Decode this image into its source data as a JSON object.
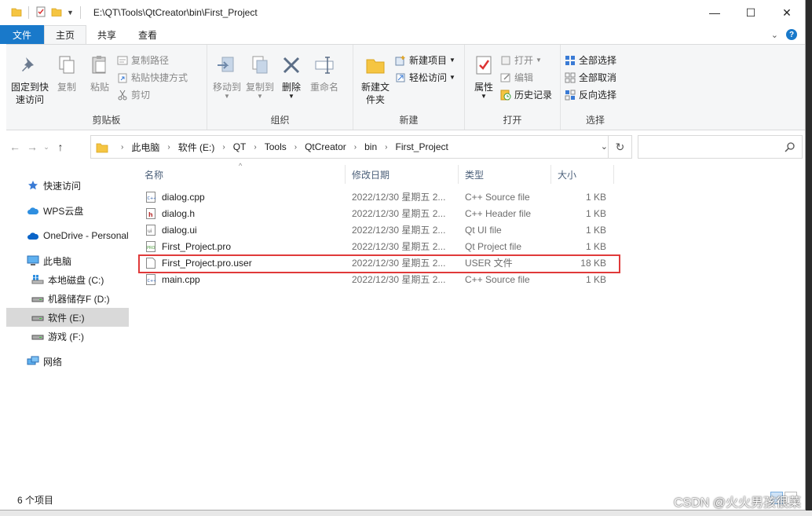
{
  "window": {
    "path": "E:\\QT\\Tools\\QtCreator\\bin\\First_Project",
    "minimize": "—",
    "maximize": "☐",
    "close": "✕"
  },
  "tabs": {
    "file": "文件",
    "home": "主页",
    "share": "共享",
    "view": "查看"
  },
  "ribbon": {
    "clipboard": {
      "label": "剪贴板",
      "pin": "固定到快速访问",
      "copy": "复制",
      "paste": "粘贴",
      "copy_path": "复制路径",
      "paste_shortcut": "粘贴快捷方式",
      "cut": "剪切"
    },
    "organize": {
      "label": "组织",
      "move_to": "移动到",
      "copy_to": "复制到",
      "delete": "删除",
      "rename": "重命名"
    },
    "new": {
      "label": "新建",
      "new_folder": "新建文件夹",
      "new_item": "新建项目",
      "easy_access": "轻松访问"
    },
    "open": {
      "label": "打开",
      "properties": "属性",
      "open": "打开",
      "edit": "编辑",
      "history": "历史记录"
    },
    "select": {
      "label": "选择",
      "select_all": "全部选择",
      "select_none": "全部取消",
      "invert": "反向选择"
    }
  },
  "breadcrumb": [
    "此电脑",
    "软件 (E:)",
    "QT",
    "Tools",
    "QtCreator",
    "bin",
    "First_Project"
  ],
  "search": {
    "placeholder": ""
  },
  "nav": {
    "quick_access": "快速访问",
    "wps": "WPS云盘",
    "onedrive": "OneDrive - Personal",
    "this_pc": "此电脑",
    "drive_c": "本地磁盘 (C:)",
    "drive_d": "机器储存F (D:)",
    "drive_e": "软件 (E:)",
    "drive_f": "游戏 (F:)",
    "network": "网络"
  },
  "columns": {
    "name": "名称",
    "date": "修改日期",
    "type": "类型",
    "size": "大小"
  },
  "files": [
    {
      "name": "dialog.cpp",
      "date": "2022/12/30 星期五 2...",
      "type": "C++ Source file",
      "size": "1 KB",
      "icon": "cpp-file-icon"
    },
    {
      "name": "dialog.h",
      "date": "2022/12/30 星期五 2...",
      "type": "C++ Header file",
      "size": "1 KB",
      "icon": "header-file-icon"
    },
    {
      "name": "dialog.ui",
      "date": "2022/12/30 星期五 2...",
      "type": "Qt UI file",
      "size": "1 KB",
      "icon": "ui-file-icon"
    },
    {
      "name": "First_Project.pro",
      "date": "2022/12/30 星期五 2...",
      "type": "Qt Project file",
      "size": "1 KB",
      "icon": "pro-file-icon"
    },
    {
      "name": "First_Project.pro.user",
      "date": "2022/12/30 星期五 2...",
      "type": "USER 文件",
      "size": "18 KB",
      "icon": "blank-file-icon"
    },
    {
      "name": "main.cpp",
      "date": "2022/12/30 星期五 2...",
      "type": "C++ Source file",
      "size": "1 KB",
      "icon": "cpp-file-icon"
    }
  ],
  "status": {
    "count": "6 个项目"
  },
  "watermark": "CSDN @火火男孩很菜",
  "colors": {
    "accent": "#1979ca",
    "highlight_border": "#e03a3a",
    "folder": "#f5c542"
  }
}
